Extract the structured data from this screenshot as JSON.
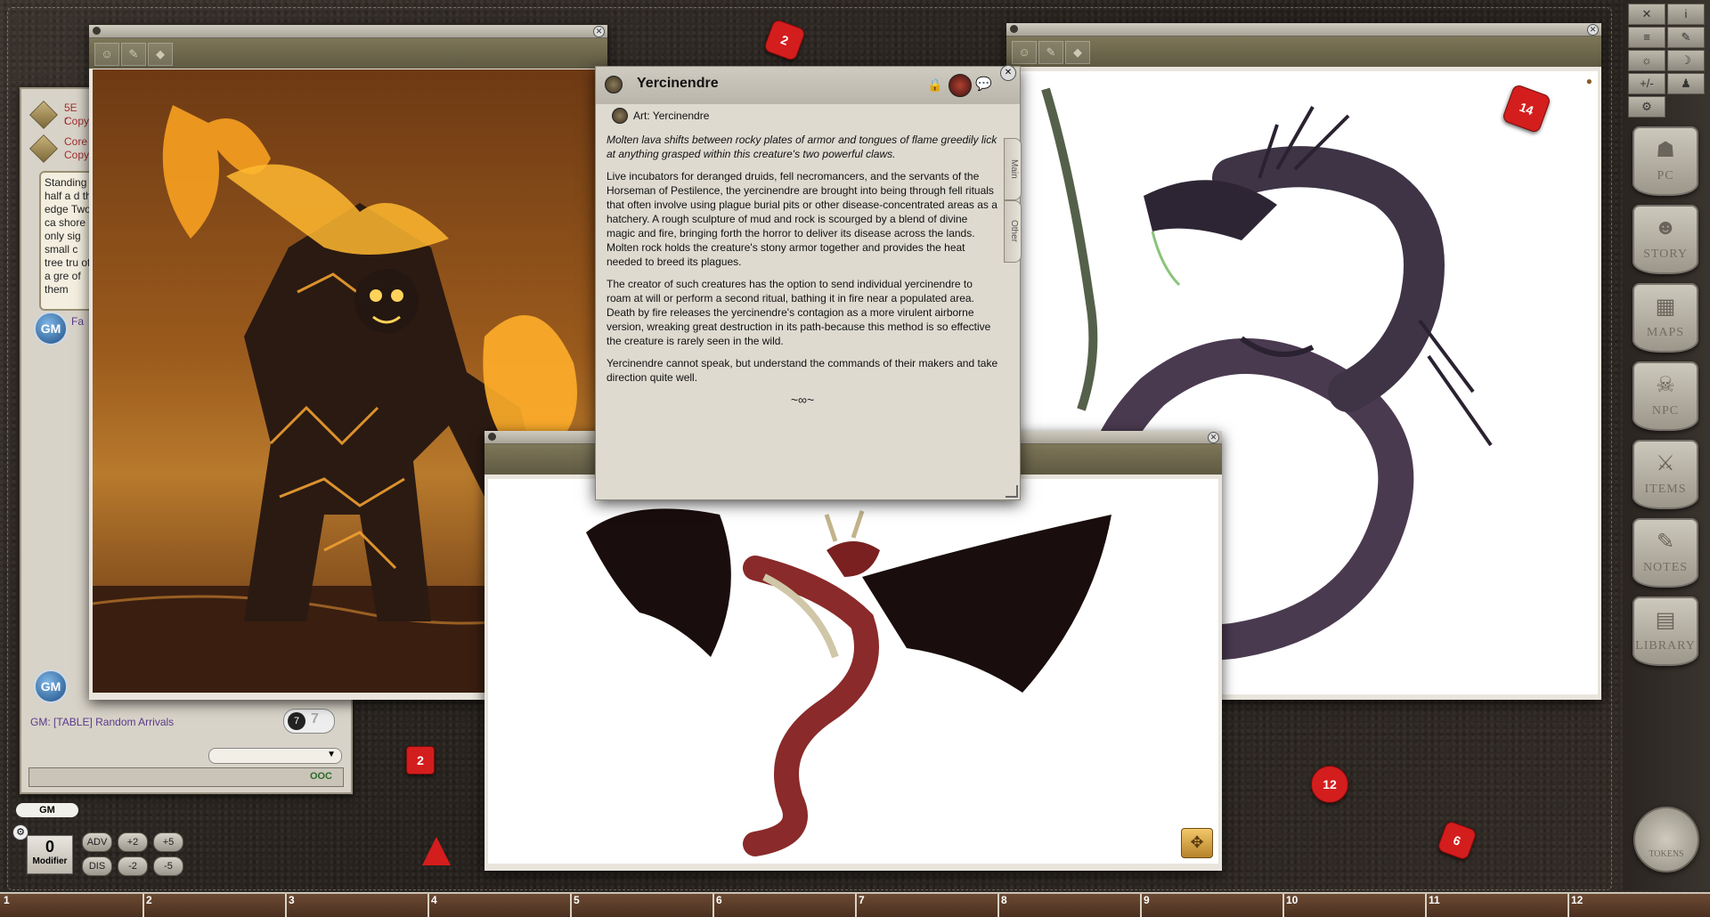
{
  "chat": {
    "entry1_text": "5E r",
    "entry1_sub": "Copy",
    "entry2_text": "Core",
    "entry2_sub": "Copy",
    "story_text": "Standing half a d the edge Two ca shore n only sig small c tree tru of a gre of them",
    "gm_label": "GM",
    "gm_msg_fragment": "Fa",
    "roll_line": "GM:  [TABLE] Random Arrivals",
    "roll_value_a": "7",
    "roll_value_b": "7",
    "mode_button": "OOC",
    "identity": "GM"
  },
  "info_window": {
    "title": "Yercinendre",
    "art_link": "Art: Yercinendre",
    "tab_main": "Main",
    "tab_other": "Other",
    "intro": "Molten lava shifts between rocky plates of armor and tongues of flame greedily lick at anything grasped within this creature's two powerful claws.",
    "para1": "Live incubators for deranged druids, fell necromancers, and the servants of the Horseman of Pestilence, the yercinendre are brought into being through fell rituals that often involve using plague burial pits or other disease-concentrated areas as a hatchery. A rough sculpture of mud and rock is scourged by a blend of divine magic and fire, bringing forth the horror to deliver its disease across the lands. Molten rock holds the creature's stony armor together and provides the heat needed to breed its plagues.",
    "para2": "The creator of such creatures has the option to send individual yercinendre to roam at will or perform a second ritual, bathing it in fire near a populated area. Death by fire releases the yercinendre's contagion as a more virulent airborne version, wreaking great destruction in its path-because this method is so effective the creature is rarely seen in the wild.",
    "para3": "Yercinendre cannot speak, but understand the commands of their makers and take direction quite well.",
    "flourish": "~∞~"
  },
  "modifier": {
    "value": "0",
    "label": "Modifier",
    "adv": "ADV",
    "dis": "DIS",
    "p2": "+2",
    "p5": "+5",
    "m2": "-2",
    "m5": "-5"
  },
  "sidebar": {
    "buttons": [
      {
        "label": "PC",
        "icon": "☗"
      },
      {
        "label": "STORY",
        "icon": "☻"
      },
      {
        "label": "MAPS",
        "icon": "▦"
      },
      {
        "label": "NPC",
        "icon": "☠"
      },
      {
        "label": "ITEMS",
        "icon": "⚔"
      },
      {
        "label": "NOTES",
        "icon": "✎"
      },
      {
        "label": "LIBRARY",
        "icon": "▤"
      }
    ],
    "tokens_label": "TOKENS",
    "tools": [
      "✕",
      "i",
      "≡",
      "✎",
      "☼",
      "☽",
      "+/-",
      "♟",
      "⚙"
    ]
  },
  "dice": {
    "d1": "2",
    "d2": "14",
    "d3": "2",
    "d4": "12",
    "d5": "6"
  },
  "hotbar": {
    "slots": [
      "1",
      "2",
      "3",
      "4",
      "5",
      "6",
      "7",
      "8",
      "9",
      "10",
      "11",
      "12"
    ]
  }
}
